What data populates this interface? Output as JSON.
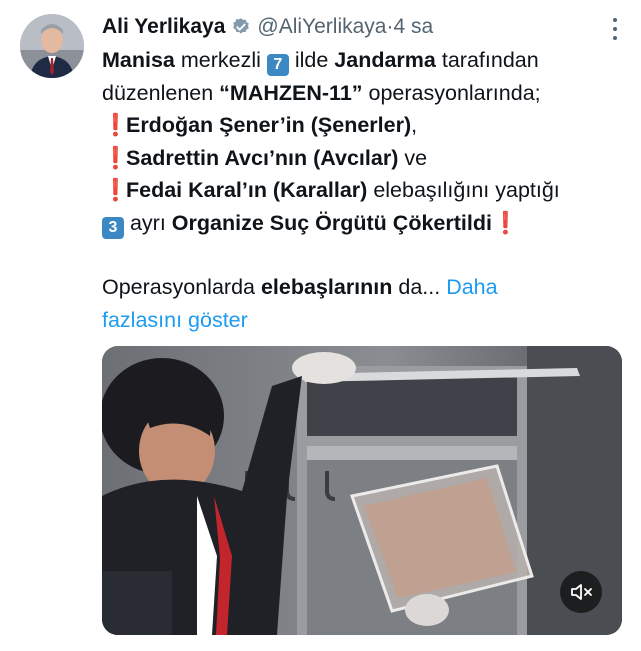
{
  "tweet": {
    "author_name": "Ali Yerlikaya",
    "author_handle": "@AliYerlikaya",
    "separator": " · ",
    "time_ago": "4 sa",
    "lines": [
      [
        {
          "t": "Manisa",
          "b": true
        },
        {
          "t": " merkezli "
        },
        {
          "k": "7"
        },
        {
          "t": " ilde "
        },
        {
          "t": "Jandarma",
          "b": true
        },
        {
          "t": " tarafından"
        }
      ],
      [
        {
          "t": "düzenlenen "
        },
        {
          "t": "“MAHZEN-11”",
          "b": true
        },
        {
          "t": " operasyonlarında;"
        }
      ],
      [
        {
          "e": "❗"
        },
        {
          "t": " Erdoğan Şener’in (Şenerler)",
          "b": true
        },
        {
          "t": ","
        }
      ],
      [
        {
          "e": "❗"
        },
        {
          "t": " Sadrettin Avcı’nın (Avcılar)",
          "b": true
        },
        {
          "t": " ve"
        }
      ],
      [
        {
          "e": "❗"
        },
        {
          "t": " Fedai Karal’ın (Karallar)",
          "b": true
        },
        {
          "t": " elebaşılığını yaptığı"
        }
      ],
      [
        {
          "k": "3"
        },
        {
          "t": " ayrı "
        },
        {
          "t": "Organize Suç Örgütü Çökertildi",
          "b": true
        },
        {
          "e": " ❗"
        }
      ]
    ],
    "more_text": {
      "prefix": "Operasyonlarda ",
      "bold": "elebaşlarının",
      "suffix": " da...",
      "link1": "Daha",
      "link2": "fazlasını göster"
    }
  },
  "icons": {
    "verified": "verified-badge-icon",
    "more": "more-options-icon",
    "mute": "volume-muted-icon"
  },
  "colors": {
    "link": "#1d9bf0",
    "verified": "#829aab",
    "exclamation": "#d32f2f",
    "keycap": "#3b88c3"
  }
}
